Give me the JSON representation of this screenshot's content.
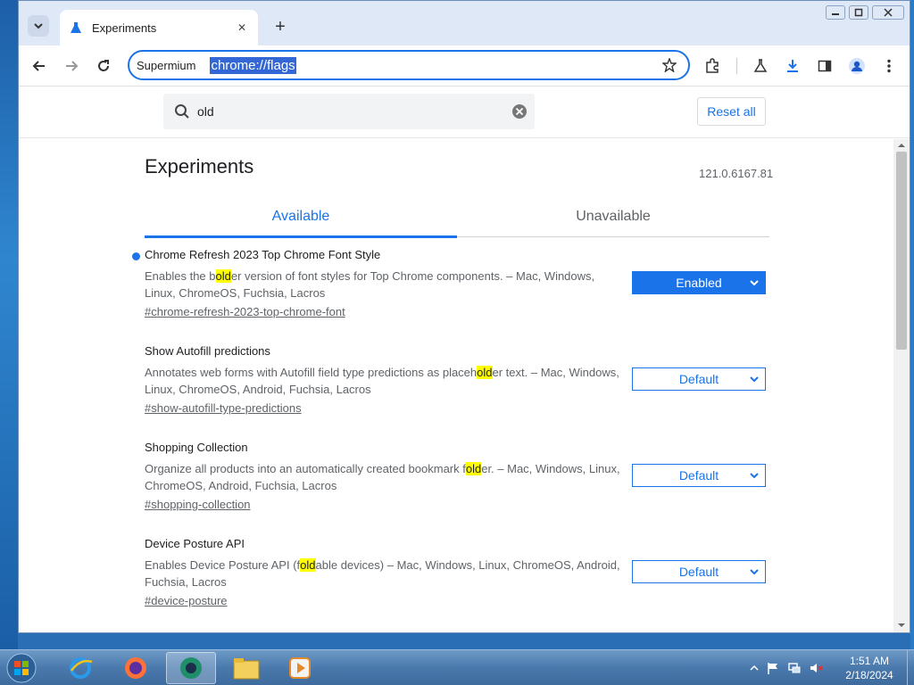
{
  "browser": {
    "tab_title": "Experiments",
    "omnibox_chip": "Supermium",
    "url": "chrome://flags"
  },
  "flags_page": {
    "search_value": "old",
    "reset_label": "Reset all",
    "title": "Experiments",
    "version": "121.0.6167.81",
    "tabs": {
      "available": "Available",
      "unavailable": "Unavailable"
    },
    "flags": [
      {
        "name": "Chrome Refresh 2023 Top Chrome Font Style",
        "desc_pre": "Enables the b",
        "desc_hl": "old",
        "desc_post": "er version of font styles for Top Chrome components. – Mac, Windows, Linux, ChromeOS, Fuchsia, Lacros",
        "link": "#chrome-refresh-2023-top-chrome-font",
        "value": "Enabled"
      },
      {
        "name": "Show Autofill predictions",
        "desc_pre": "Annotates web forms with Autofill field type predictions as placeh",
        "desc_hl": "old",
        "desc_post": "er text. – Mac, Windows, Linux, ChromeOS, Android, Fuchsia, Lacros",
        "link": "#show-autofill-type-predictions",
        "value": "Default"
      },
      {
        "name": "Shopping Collection",
        "desc_pre": "Organize all products into an automatically created bookmark f",
        "desc_hl": "old",
        "desc_post": "er. – Mac, Windows, Linux, ChromeOS, Android, Fuchsia, Lacros",
        "link": "#shopping-collection",
        "value": "Default"
      },
      {
        "name": "Device Posture API",
        "desc_pre": "Enables Device Posture API (f",
        "desc_hl": "old",
        "desc_post": "able devices) – Mac, Windows, Linux, ChromeOS, Android, Fuchsia, Lacros",
        "link": "#device-posture",
        "value": "Default"
      }
    ]
  },
  "taskbar": {
    "time": "1:51 AM",
    "date": "2/18/2024"
  },
  "colors": {
    "accent": "#1a73e8",
    "highlight": "#ffff00"
  }
}
